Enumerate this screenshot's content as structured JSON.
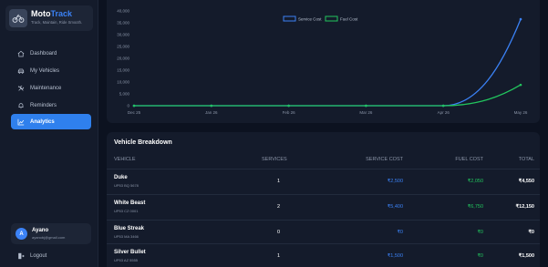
{
  "app": {
    "name_prefix": "Moto",
    "name_accent": "Track",
    "tagline": "Track, Maintain, Ride Smooth."
  },
  "sidebar": {
    "items": [
      {
        "label": "Dashboard",
        "icon": "home-icon"
      },
      {
        "label": "My Vehicles",
        "icon": "car-icon"
      },
      {
        "label": "Maintenance",
        "icon": "wrench-icon"
      },
      {
        "label": "Reminders",
        "icon": "bell-icon"
      },
      {
        "label": "Analytics",
        "icon": "chart-icon",
        "active": true
      }
    ],
    "logout_label": "Logout"
  },
  "user": {
    "initial": "A",
    "name": "Ayano",
    "email": "ayanobj@gmail.com"
  },
  "chart": {
    "legend": [
      {
        "label": "Service Cost",
        "color": "#3b82f6"
      },
      {
        "label": "Fuel Cost",
        "color": "#22c55e"
      }
    ]
  },
  "chart_data": {
    "type": "line",
    "x": [
      "Dec 25",
      "Jan 26",
      "Feb 26",
      "Mar 26",
      "Apr 26",
      "May 26"
    ],
    "ylim": [
      0,
      40000
    ],
    "yticks": [
      "0",
      "5,000",
      "10,000",
      "15,000",
      "20,000",
      "25,000",
      "30,000",
      "35,000",
      "40,000"
    ],
    "ytick_values": [
      0,
      5000,
      10000,
      15000,
      20000,
      25000,
      30000,
      35000,
      40000
    ],
    "legend_position": "top-center",
    "grid": false,
    "series": [
      {
        "name": "Service Cost",
        "color": "#3b82f6",
        "values": [
          0,
          0,
          0,
          0,
          0,
          36500
        ]
      },
      {
        "name": "Fuel Cost",
        "color": "#22c55e",
        "values": [
          0,
          0,
          0,
          0,
          0,
          8800
        ]
      }
    ]
  },
  "breakdown": {
    "title": "Vehicle Breakdown",
    "headers": {
      "vehicle": "VEHICLE",
      "services": "SERVICES",
      "service_cost": "SERVICE COST",
      "fuel_cost": "FUEL COST",
      "total": "TOTAL"
    },
    "rows": [
      {
        "name": "Duke",
        "plate": "UP53 BQ 5678",
        "services": "1",
        "service_cost": "₹2,500",
        "fuel_cost": "₹2,050",
        "total": "₹4,550"
      },
      {
        "name": "White Beast",
        "plate": "UP53 CZ 0001",
        "services": "2",
        "service_cost": "₹5,400",
        "fuel_cost": "₹6,750",
        "total": "₹12,150"
      },
      {
        "name": "Blue Streak",
        "plate": "UP53 MA 3466",
        "services": "0",
        "service_cost": "₹0",
        "fuel_cost": "₹0",
        "total": "₹0"
      },
      {
        "name": "Silver Bullet",
        "plate": "UP53 AZ 5555",
        "services": "1",
        "service_cost": "₹1,500",
        "fuel_cost": "₹0",
        "total": "₹1,500"
      }
    ]
  }
}
